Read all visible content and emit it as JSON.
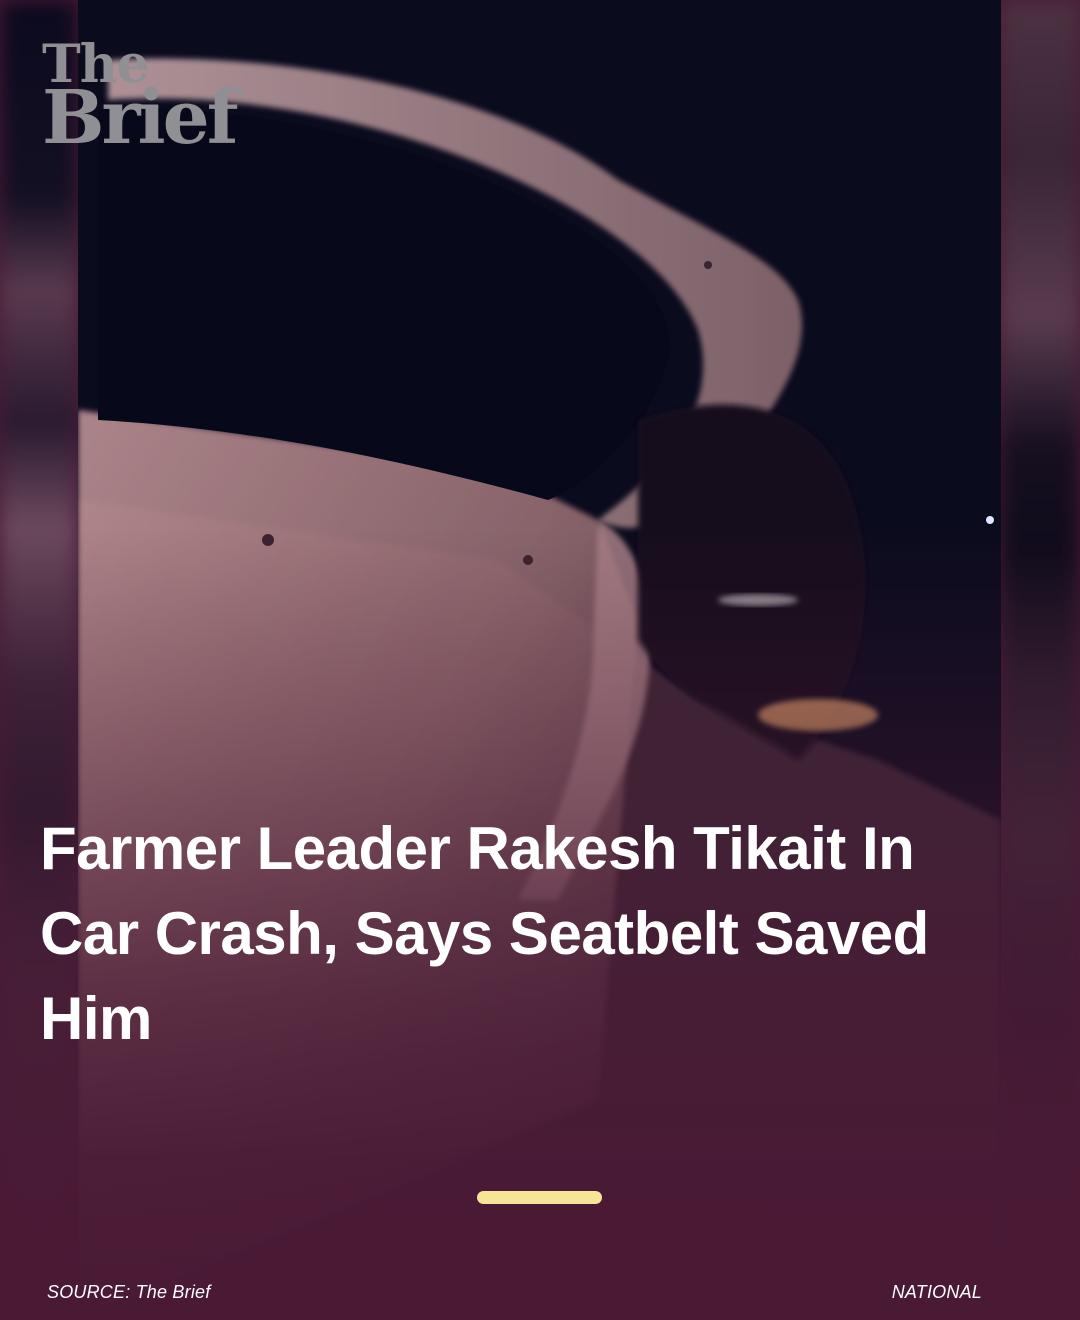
{
  "brand": {
    "logo_line1": "The",
    "logo_line2": "Brief"
  },
  "story": {
    "photo_description_icon": "car-crash-photo",
    "headline": "Farmer Leader Rakesh Tikait In Car Crash, Says Seatbelt Saved Him"
  },
  "footer": {
    "source": "SOURCE: The Brief",
    "category": "NATIONAL"
  },
  "colors": {
    "background": "#4a1a35",
    "indicator": "#f6e597",
    "logo": "#8f8f94",
    "headline": "#ffffff"
  }
}
